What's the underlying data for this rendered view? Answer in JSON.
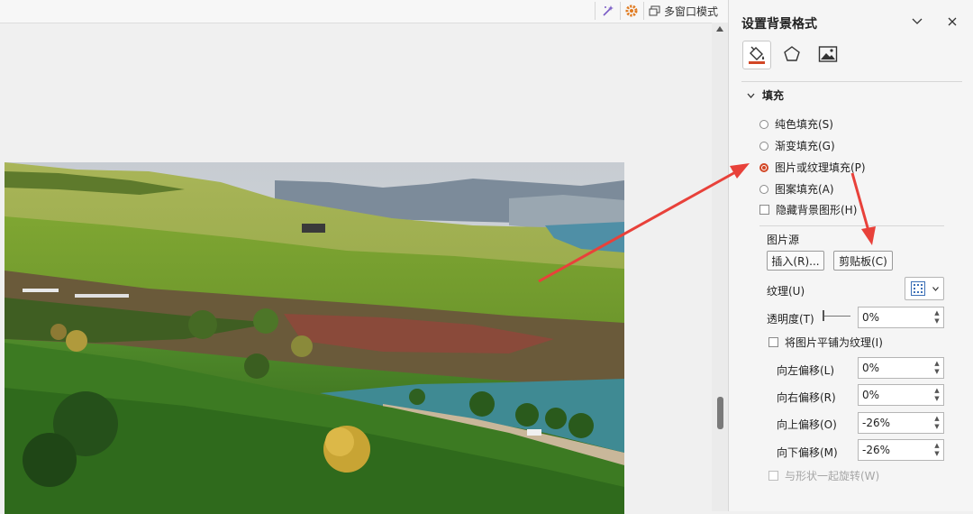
{
  "topbar": {
    "multi_window_label": "多窗口模式",
    "icons": [
      "magic-icon",
      "settings-icon",
      "window-icon"
    ]
  },
  "panel": {
    "title": "设置背景格式",
    "tabs": [
      "fill-tab",
      "effects-tab",
      "picture-tab"
    ],
    "section_label": "填充",
    "fill_options": [
      {
        "label": "纯色填充(S)",
        "selected": false
      },
      {
        "label": "渐变填充(G)",
        "selected": false
      },
      {
        "label": "图片或纹理填充(P)",
        "selected": true
      },
      {
        "label": "图案填充(A)",
        "selected": false
      }
    ],
    "hide_bg_label": "隐藏背景图形(H)",
    "picture_source_label": "图片源",
    "insert_button": "插入(R)...",
    "clipboard_button": "剪贴板(C)",
    "texture_label": "纹理(U)",
    "transparency_label": "透明度(T)",
    "transparency_value": "0%",
    "tile_label": "将图片平铺为纹理(I)",
    "offset_left_label": "向左偏移(L)",
    "offset_left_value": "0%",
    "offset_right_label": "向右偏移(R)",
    "offset_right_value": "0%",
    "offset_top_label": "向上偏移(O)",
    "offset_top_value": "-26%",
    "offset_bottom_label": "向下偏移(M)",
    "offset_bottom_value": "-26%",
    "rotate_label": "与形状一起旋转(W)"
  },
  "colors": {
    "accent": "#d24726",
    "annotation_arrow": "#e8413a"
  }
}
